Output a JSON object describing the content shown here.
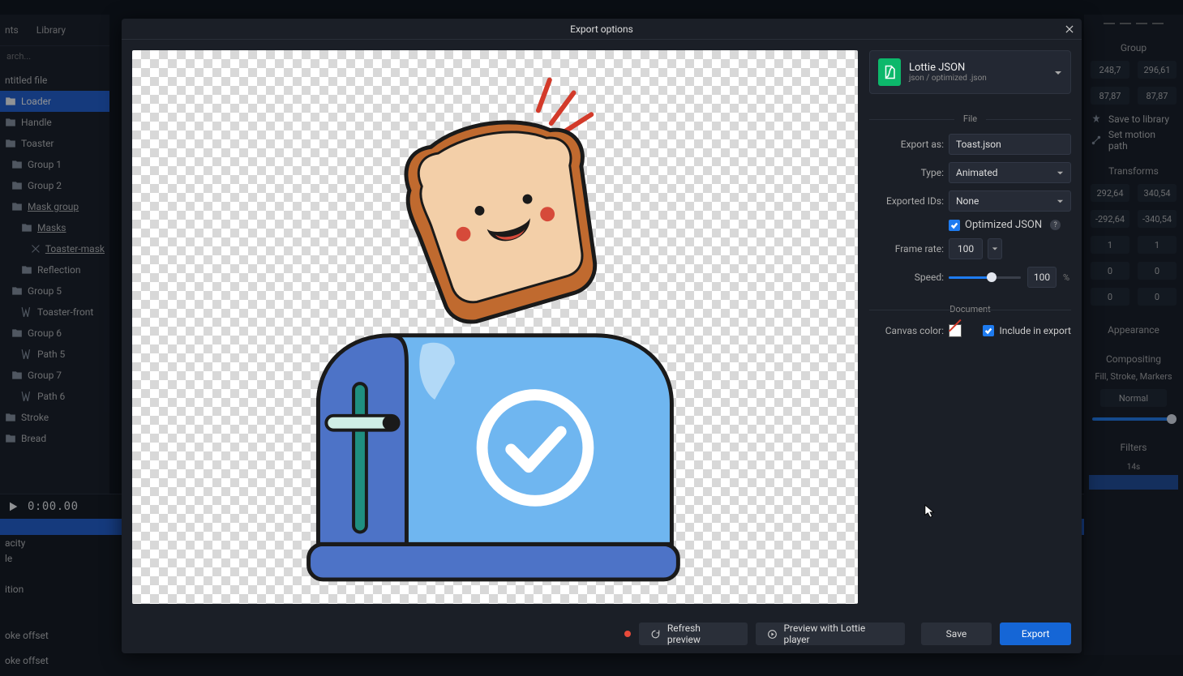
{
  "bg": {
    "tabs": [
      "nts",
      "Library"
    ],
    "search_placeholder": "arch...",
    "tree": {
      "untitled": "ntitled file",
      "loader": "Loader",
      "handle": "Handle",
      "toaster": "Toaster",
      "group1": "Group 1",
      "group2": "Group 2",
      "mask_group": "Mask group",
      "masks": "Masks",
      "toaster_mask": "Toaster-mask",
      "reflection": "Reflection",
      "group5": "Group 5",
      "toaster_front": "Toaster-front",
      "group6": "Group 6",
      "path5": "Path 5",
      "group7": "Group 7",
      "path6": "Path 6",
      "stroke": "Stroke",
      "bread": "Bread"
    },
    "timecode": "0:00.00",
    "tl": {
      "opacity": "acity",
      "scale": "le",
      "position": "ition",
      "offset1": "oke offset",
      "offset2": "oke offset"
    },
    "right": {
      "group": "Group",
      "x": "248,7",
      "y": "296,61",
      "w": "87,87",
      "h": "87,87",
      "save_library": "Save to library",
      "set_motion": "Set motion path",
      "transforms": "Transforms",
      "tx1": "292,64",
      "ty1": "340,54",
      "tx2": "-292,64",
      "ty2": "-340,54",
      "one_a": "1",
      "one_b": "1",
      "zero_a": "0",
      "zero_b": "0",
      "zero_c": "0",
      "zero_d": "0",
      "appearance": "Appearance",
      "compositing": "Compositing",
      "fill_stroke": "Fill, Stroke, Markers",
      "blend": "Normal",
      "filters": "Filters",
      "time_marker": "14s"
    }
  },
  "modal": {
    "title": "Export options",
    "format": {
      "name": "Lottie JSON",
      "sub": "json / optimized .json"
    },
    "sections": {
      "file": "File",
      "document": "Document"
    },
    "labels": {
      "export_as": "Export as:",
      "type": "Type:",
      "exported_ids": "Exported IDs:",
      "frame_rate": "Frame rate:",
      "speed": "Speed:",
      "canvas_color": "Canvas color:",
      "optimized_json": "Optimized JSON",
      "include_in_export": "Include in export"
    },
    "values": {
      "export_as": "Toast.json",
      "type": "Animated",
      "exported_ids": "None",
      "frame_rate": "100",
      "speed_value": "100",
      "speed_unit": "%",
      "slider_pct": 60
    },
    "footer": {
      "refresh": "Refresh preview",
      "player": "Preview with Lottie player",
      "save": "Save",
      "export": "Export"
    }
  }
}
